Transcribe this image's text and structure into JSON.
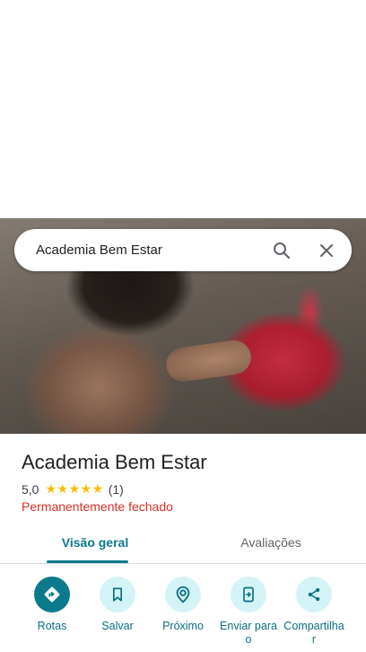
{
  "search": {
    "query": "Academia Bem Estar",
    "search_icon": "search-icon",
    "close_icon": "close-icon"
  },
  "place": {
    "name": "Academia Bem Estar",
    "rating": "5,0",
    "stars": "★★★★★",
    "review_count": "(1)",
    "status": "Permanentemente fechado"
  },
  "tabs": [
    {
      "label": "Visão geral",
      "active": true
    },
    {
      "label": "Avaliações",
      "active": false
    }
  ],
  "actions": [
    {
      "label": "Rotas",
      "icon": "directions-icon"
    },
    {
      "label": "Salvar",
      "icon": "bookmark-icon"
    },
    {
      "label": "Próximo",
      "icon": "nearby-icon"
    },
    {
      "label": "Enviar para o",
      "icon": "send-to-phone-icon"
    },
    {
      "label": "Compartilhar",
      "icon": "share-icon"
    }
  ],
  "colors": {
    "accent": "#0a7a8c",
    "action_bg": "#d4f3f7",
    "status_red": "#d93025",
    "star": "#fbbc04"
  }
}
